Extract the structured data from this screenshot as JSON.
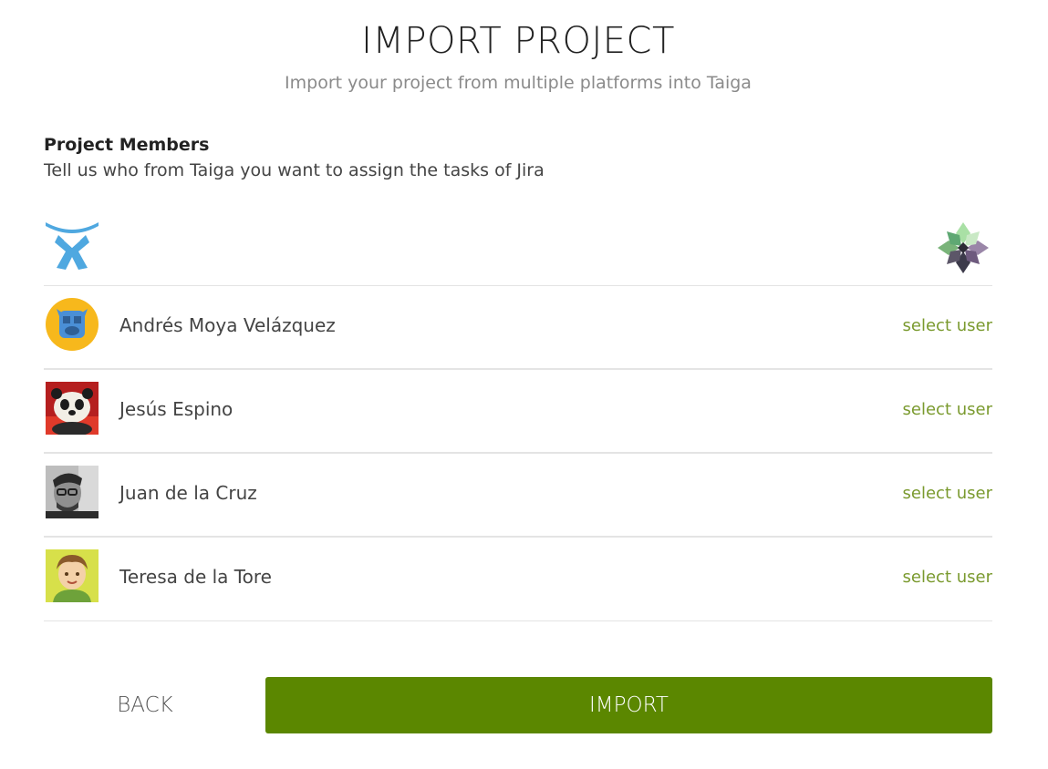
{
  "header": {
    "title": "IMPORT PROJECT",
    "subtitle": "Import your project from multiple platforms into Taiga"
  },
  "section": {
    "title": "Project Members",
    "description": "Tell us who from Taiga you want to assign the tasks of Jira"
  },
  "logos": {
    "source": "jira-logo-icon",
    "target": "taiga-logo-icon"
  },
  "members": [
    {
      "name": "Andrés Moya Velázquez",
      "avatar": "avatar-default-icon",
      "action": "select user"
    },
    {
      "name": "Jesús Espino",
      "avatar": "avatar-panda-photo",
      "action": "select user"
    },
    {
      "name": "Juan de la Cruz",
      "avatar": "avatar-man-photo",
      "action": "select user"
    },
    {
      "name": "Teresa de la Tore",
      "avatar": "avatar-cartoon-photo",
      "action": "select user"
    }
  ],
  "footer": {
    "back_label": "BACK",
    "import_label": "IMPORT"
  },
  "colors": {
    "accent": "#5b8700",
    "link": "#7a9a2e",
    "divider": "#e4e4e4"
  }
}
